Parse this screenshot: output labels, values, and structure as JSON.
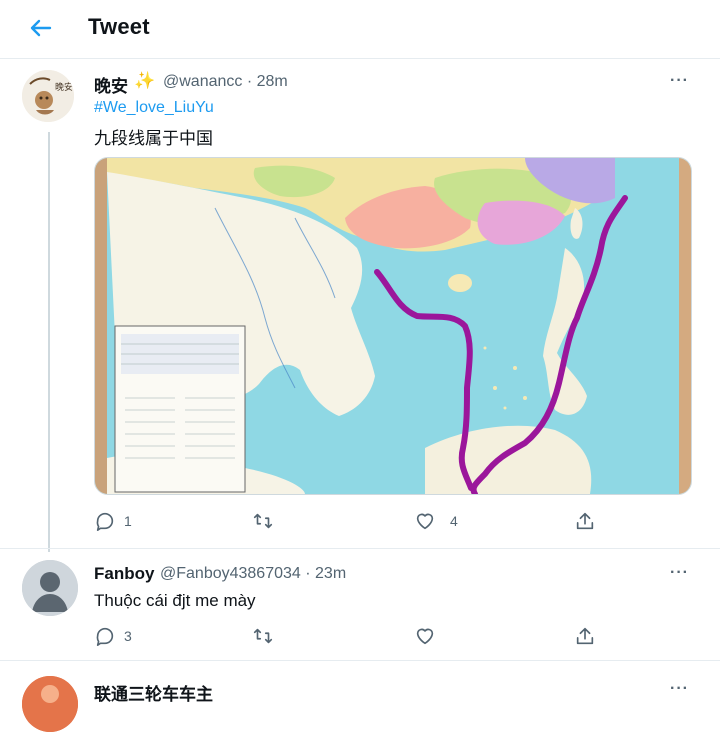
{
  "header": {
    "title": "Tweet"
  },
  "tweet1": {
    "name": "晚安",
    "emoji": "✨",
    "handle_time": "@wanancc · 28m",
    "more": "···",
    "hashtag": "#We_love_LiuYu",
    "text": "九段线属于中国",
    "actions": {
      "reply_count": "1",
      "like_count": "4"
    }
  },
  "tweet2": {
    "name": "Fanboy",
    "handle_time": "@Fanboy43867034 · 23m",
    "more": "···",
    "text": "Thuộc cái đjt me mày",
    "actions": {
      "reply_count": "3"
    }
  },
  "tweet3": {
    "name": "联通三轮车车主",
    "more": "···"
  },
  "colors": {
    "accent": "#1d9bf0",
    "text": "#0f1419",
    "muted": "#536471",
    "line": "#9b169b"
  }
}
